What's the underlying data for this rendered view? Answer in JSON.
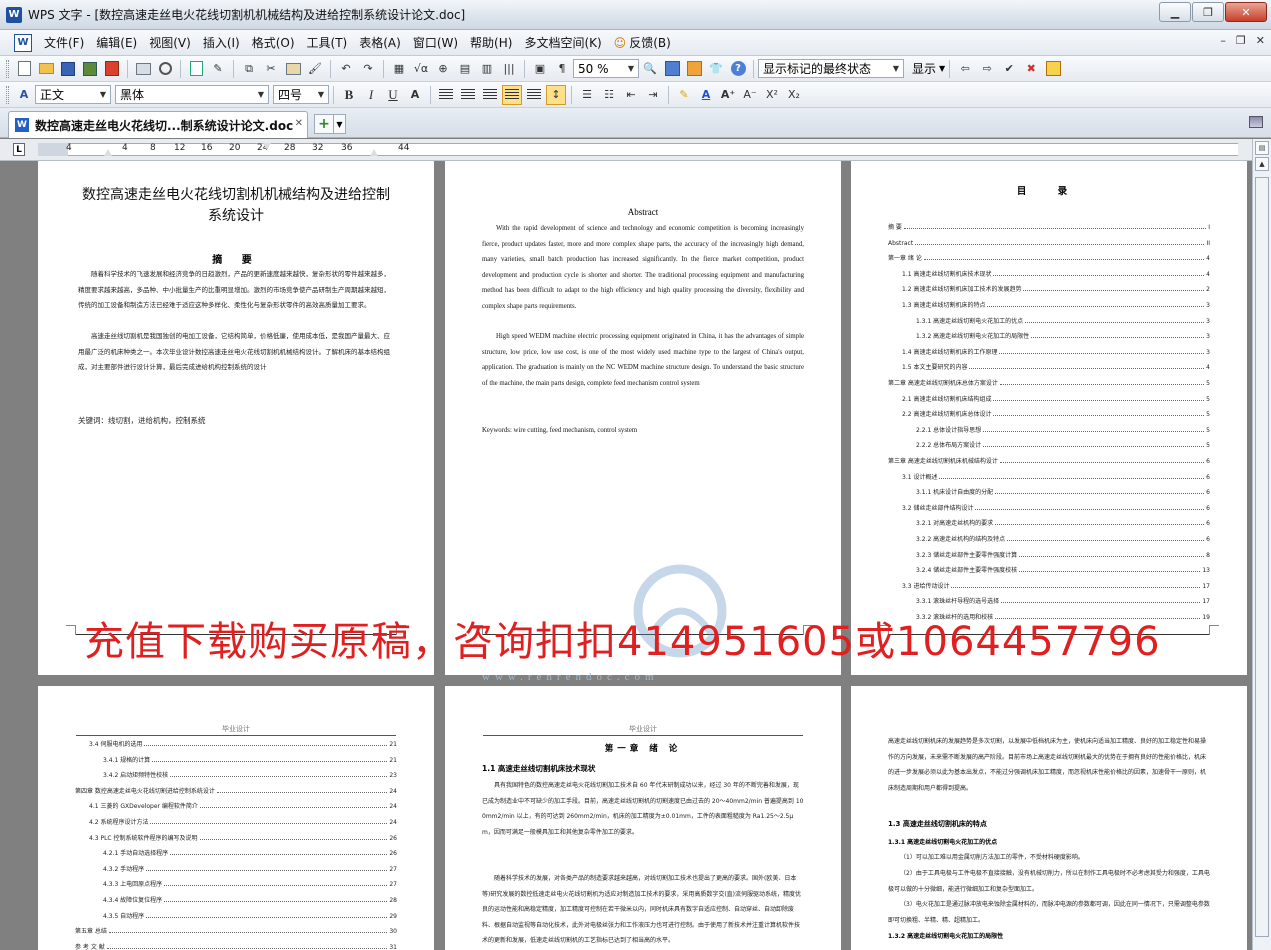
{
  "window": {
    "title": "WPS 文字 - [数控高速走丝电火花线切割机机械结构及进给控制系统设计论文.doc]",
    "app_icon": "W"
  },
  "menu": {
    "items": [
      "文件(F)",
      "编辑(E)",
      "视图(V)",
      "插入(I)",
      "格式(O)",
      "工具(T)",
      "表格(A)",
      "窗口(W)",
      "帮助(H)",
      "多文档空间(K)",
      "反馈(B)"
    ]
  },
  "toolbar": {
    "zoom": "50 %",
    "track_mode": "显示标记的最终状态",
    "display_label": "显示"
  },
  "format": {
    "style": "正文",
    "font": "黑体",
    "size": "四号",
    "bold": "B",
    "italic": "I",
    "underline": "U",
    "superscript": "X²",
    "subscript": "X₂"
  },
  "tab": {
    "label": "数控高速走丝电火花线切...制系统设计论文.doc"
  },
  "ruler": {
    "corner": "L",
    "ticks": [
      "4",
      "4",
      "8",
      "12",
      "16",
      "20",
      "24",
      "28",
      "32",
      "36",
      "44"
    ]
  },
  "pages": {
    "p1": {
      "title": "数控高速走丝电火花线切割机机械结构及进给控制系统设计",
      "abstract_heading": "摘 要",
      "para1": "随着科学技术的飞速发展和经济竞争的日趋激烈，产品的更新速度越来越快，复杂形状的零件越来越多，精度要求越来越高，多品种、中小批量生产的比重明显增加。激烈的市场竞争使产品研制生产周期越来越短，传统的加工设备和制造方法已经难于适应这种多样化、柔性化与复杂形状零件的高效高质量加工要求。",
      "para2": "高速走丝线切割机是我国独创的电加工设备，它结构简单，价格低廉，使用成本低，是我国产量最大、应用最广泛的机床种类之一。本次毕业设计数控高速走丝电火花线切割机机械结构设计。了解机床的基本结构组成，对主要部件进行设计计算，最后完成进给机构控制系统的设计",
      "keywords": "关键词：线切割，进给机构，控制系统"
    },
    "p2": {
      "title": "Abstract",
      "para1": "With the rapid development of science and technology and economic competition is becoming increasingly fierce, product updates faster, more and more complex shape parts, the accuracy of the increasingly high demand, many varieties, small batch production has increased significantly. In the fierce market competition, product development and production cycle is shorter and shorter. The traditional processing equipment and manufacturing method has been difficult to adapt to the high efficiency and high quality processing the diversity, flexibility and complex shape parts requirements.",
      "para2": "High speed WEDM machine electric processing equipment originated in China, it has the advantages of simple structure, low price, low use cost, is one of the most widely used machine type to the largest of China's output, application. The graduation is mainly on the NC WEDM machine structure design. To understand the basic structure of the machine, the main parts design, complete feed mechanism control system",
      "keywords": "Keywords: wire cutting, feed mechanism, control system"
    },
    "p3": {
      "title": "目 录",
      "toc": [
        {
          "t": "摘 要",
          "n": "I",
          "lvl": 0
        },
        {
          "t": "Abstract",
          "n": "II",
          "lvl": 0
        },
        {
          "t": "第一章 绪 论",
          "n": "4",
          "lvl": 0
        },
        {
          "t": "1.1 高速走丝线切割机床技术现状",
          "n": "4",
          "lvl": 1
        },
        {
          "t": "1.2 高速走丝线切割机床加工技术的发展趋势",
          "n": "2",
          "lvl": 1
        },
        {
          "t": "1.3 高速走丝线切割机床的特点",
          "n": "3",
          "lvl": 1
        },
        {
          "t": "1.3.1 高速走丝线切割电火花加工的优点",
          "n": "3",
          "lvl": 2
        },
        {
          "t": "1.3.2 高速走丝线切割电火花加工的局限性",
          "n": "3",
          "lvl": 2
        },
        {
          "t": "1.4 高速走丝线切割机床的工作原理",
          "n": "3",
          "lvl": 1
        },
        {
          "t": "1.5 本文主要研究的内容",
          "n": "4",
          "lvl": 1
        },
        {
          "t": "第二章 高速走丝线切割机床总体方案设计",
          "n": "5",
          "lvl": 0
        },
        {
          "t": "2.1 高速走丝线切割机床结构组成",
          "n": "5",
          "lvl": 1
        },
        {
          "t": "2.2 高速走丝线切割机床总体设计",
          "n": "5",
          "lvl": 1
        },
        {
          "t": "2.2.1 总体设计指导思想",
          "n": "5",
          "lvl": 2
        },
        {
          "t": "2.2.2 总体布局方案设计",
          "n": "5",
          "lvl": 2
        },
        {
          "t": "第三章 高速走丝线切割机床机械结构设计",
          "n": "6",
          "lvl": 0
        },
        {
          "t": "3.1 设计概述",
          "n": "6",
          "lvl": 1
        },
        {
          "t": "3.1.1 机床设计自由度的分配",
          "n": "6",
          "lvl": 2
        },
        {
          "t": "3.2 储丝走丝部件结构设计",
          "n": "6",
          "lvl": 1
        },
        {
          "t": "3.2.1 对高速走丝机构的要求",
          "n": "6",
          "lvl": 2
        },
        {
          "t": "3.2.2 高速走丝机构的结构及特点",
          "n": "6",
          "lvl": 2
        },
        {
          "t": "3.2.3 储丝走丝部件主要零件强度计算",
          "n": "8",
          "lvl": 2
        },
        {
          "t": "3.2.4 储丝走丝部件主要零件强度校核",
          "n": "13",
          "lvl": 2
        },
        {
          "t": "3.3 进给传动设计",
          "n": "17",
          "lvl": 1
        },
        {
          "t": "3.3.1 滚珠丝杆导程的选号选择",
          "n": "17",
          "lvl": 2
        },
        {
          "t": "3.3.2 滚珠丝杆的选用和校核",
          "n": "19",
          "lvl": 2
        }
      ]
    },
    "p4": {
      "header": "毕业设计",
      "toc": [
        {
          "t": "3.4 伺服电机的选用",
          "n": "21",
          "lvl": 1
        },
        {
          "t": "3.4.1 规格的计算",
          "n": "21",
          "lvl": 2
        },
        {
          "t": "3.4.2 启动矩频特性校核",
          "n": "23",
          "lvl": 2
        },
        {
          "t": "第四章 数控高速走丝电火花线切割进给控制系统设计",
          "n": "24",
          "lvl": 0
        },
        {
          "t": "4.1 三菱的 GXDeveloper 编程软件简介",
          "n": "24",
          "lvl": 1
        },
        {
          "t": "4.2 系统程序设计方法",
          "n": "24",
          "lvl": 1
        },
        {
          "t": "4.3 PLC 控制系统软件程序的编写及说明",
          "n": "26",
          "lvl": 1
        },
        {
          "t": "4.2.1 手动自动选择程序",
          "n": "26",
          "lvl": 2
        },
        {
          "t": "4.3.2 手动程序",
          "n": "27",
          "lvl": 2
        },
        {
          "t": "4.3.3 上电回原点程序",
          "n": "27",
          "lvl": 2
        },
        {
          "t": "4.3.4 故障位复位程序",
          "n": "28",
          "lvl": 2
        },
        {
          "t": "4.3.5 自动程序",
          "n": "29",
          "lvl": 2
        },
        {
          "t": "第五章 总结",
          "n": "30",
          "lvl": 0
        },
        {
          "t": "参 考 文 献",
          "n": "31",
          "lvl": 0
        }
      ]
    },
    "p5": {
      "header": "毕业设计",
      "chapter": "第一章 绪 论",
      "section": "1.1 高速走丝线切割机床技术现状",
      "para1": "具有我国特色的数控高速走丝电火花线切割加工技术自 60 年代末研制成功以来，经过 30 年的不断完善和发展，现已成为制造业中不可缺少的加工手段。目前，高速走丝线切割机的切割速度已由过去的 20～40mm2/min 普遍提高到 100mm2/min 以上，有的可达到 260mm2/min，机床的加工精度为±0.01mm，工件的表面粗糙度为 Ra1.25～2.5μm，因而可满足一般模具加工和其他复杂零件加工的要求。",
      "para2": "随着科学技术的发展，对各类产品的制造要求越来越高，对线切割加工技术也提出了更高的要求。国外(欧美、日本等)研究发展的数控低速走丝电火花线切割机为适应对制造加工技术的要求，采用高质数字交(直)流伺服驱动系统，精度优良的运动性能和高稳定精度，加工精度可控制在若干微米以内，同时机床具有数字自适应控制、自动穿丝、自动卸除废料、根据自动监视等自动化技术，此外对电极丝张力和工作液压力也可进行控制。由于使用了新技术并注重计算机软件技术的更新和发展，低速走丝线切割机的工艺指标已达到了相当高的水平。"
    },
    "p6": {
      "para1": "高速走丝线切割机床的发展趋势是多次切割，以发展中低档机床为主，使机床向适当加工精度、良好的加工稳定性和易操作的方向发展，未来需不断发展的高产阶段。目前市场上高速走丝线切割机最大的优势在于拥有良好的性能价格比，机床的进一步发展必须以此为基本出发点，不能过分强调机床加工精度，而忽视机床性能价格比的因素，加速骨干一原则，机床制造周期和用户都得到提高。",
      "section": "1.3 高速走丝线切割机床的特点",
      "subsection1": "1.3.1 高速走丝线切割电火花加工的优点",
      "item1": "（1）可以加工难以用金属切削方法加工的零件，不受材料硬度影响。",
      "item2": "（2）由于工具电极与工件电极不直接接触，没有机械切削力，所以在制作工具电极时不必考虑其受力和强度，工具电极可以做的十分微细，能进行微细加工和复杂型面加工。",
      "item3": "（3）电火花加工是通过脉冲放电来蚀除金属材料的，而脉冲电源的参数都可调，因此在同一情况下，只需调整电参数即可切换粗、半精、精、超精加工。",
      "subsection2": "1.3.2 高速走丝线切割电火花加工的局限性"
    }
  },
  "watermark": {
    "text": "充值下载购买原稿，咨询扣扣414951605或1064457796",
    "url": "www.renrendoc.com"
  },
  "colors": {
    "watermark_red": "#e02020",
    "workspace_gray": "#808080"
  }
}
